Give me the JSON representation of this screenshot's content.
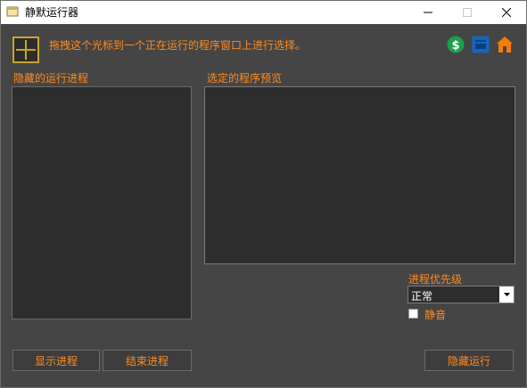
{
  "window": {
    "title": "静默运行器"
  },
  "header": {
    "instruction": "拖拽这个光标到一个正在运行的程序窗口上进行选择。",
    "icons": [
      "dollar-icon",
      "web-icon",
      "home-icon"
    ]
  },
  "left_panel": {
    "label": "隐藏的运行进程"
  },
  "right_panel": {
    "label": "选定的程序预览"
  },
  "priority": {
    "label": "进程优先级",
    "selected": "正常"
  },
  "mute": {
    "label": "静音",
    "checked": false
  },
  "buttons": {
    "show_process": "显示进程",
    "end_process": "结束进程",
    "hide_run": "隐藏运行"
  },
  "colors": {
    "accent": "#ff8a1f",
    "background": "#454545",
    "panel": "#2d2d2d",
    "dollar_green": "#1aa04a",
    "web_blue": "#1565c0",
    "home_orange": "#f57c00"
  }
}
